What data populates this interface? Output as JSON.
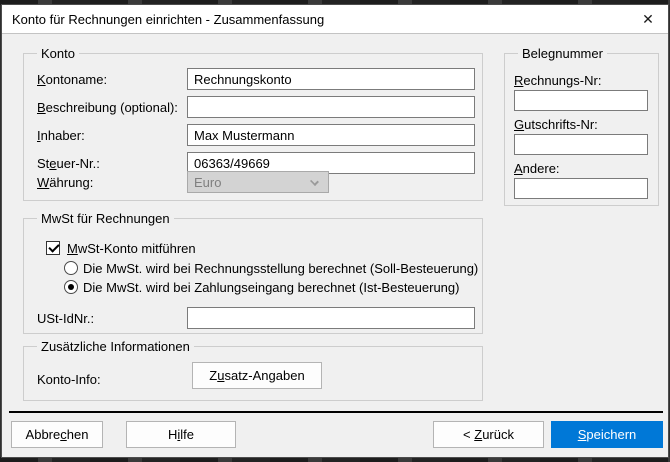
{
  "window": {
    "title": "Konto für Rechnungen einrichten - Zusammenfassung",
    "close_icon": "✕"
  },
  "colors": {
    "accent": "#0078d7",
    "dialog_bg": "#f0f0f0",
    "titlebar_bg": "#ffffff",
    "disabled_field_bg": "#d3d3d3"
  },
  "konto": {
    "legend": "Konto",
    "rows": [
      {
        "label": "Kontoname:",
        "accel": 0,
        "value": "Rechnungskonto"
      },
      {
        "label": "Beschreibung (optional):",
        "accel": 0,
        "value": ""
      },
      {
        "label": "Inhaber:",
        "accel": 0,
        "value": "Max Mustermann"
      },
      {
        "label": "Steuer-Nr.:",
        "accel": 2,
        "value": "06363/49669"
      }
    ],
    "currency": {
      "label": "Währung:",
      "accel": 0,
      "value": "Euro",
      "disabled": true
    }
  },
  "belegnummer": {
    "legend": "Belegnummer",
    "rows": [
      {
        "label": "Rechnungs-Nr:",
        "accel": 0,
        "value": ""
      },
      {
        "label": "Gutschrifts-Nr:",
        "accel": 0,
        "value": ""
      },
      {
        "label": "Andere:",
        "accel": 0,
        "value": ""
      }
    ]
  },
  "mwst": {
    "legend": "MwSt für Rechnungen",
    "checkbox": {
      "label": "MwSt-Konto mitführen",
      "accel": 0,
      "checked": true
    },
    "radios": [
      {
        "label": "Die MwSt. wird bei Rechnungsstellung berechnet (Soll-Besteuerung)",
        "selected": false
      },
      {
        "label": "Die MwSt. wird bei Zahlungseingang berechnet (Ist-Besteuerung)",
        "selected": true
      }
    ],
    "ustid": {
      "label": "USt-IdNr.:",
      "value": ""
    }
  },
  "zusatz": {
    "legend": "Zusätzliche Informationen",
    "row_label": "Konto-Info:",
    "button": {
      "label": "Zusatz-Angaben",
      "accel": 1
    }
  },
  "footer": {
    "buttons": [
      {
        "label": "Abbrechen",
        "accel": 5
      },
      {
        "label": "Hilfe",
        "accel": 1
      },
      {
        "label": "< Zurück",
        "accel": 2
      },
      {
        "label": "Speichern",
        "accel": 0
      }
    ]
  }
}
